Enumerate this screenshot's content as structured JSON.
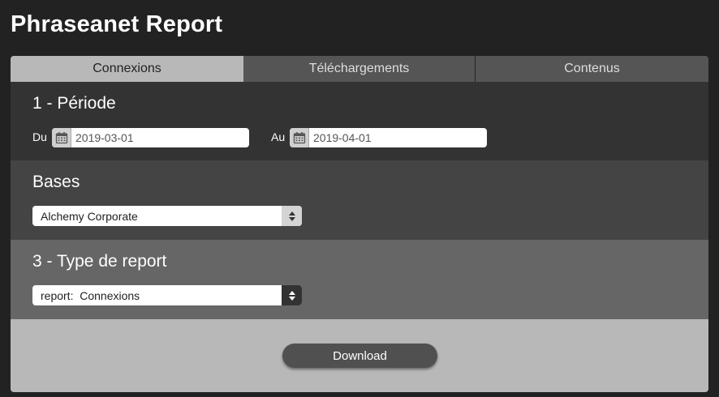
{
  "app": {
    "title": "Phraseanet Report"
  },
  "tabs": [
    {
      "label": "Connexions",
      "active": true
    },
    {
      "label": "Téléchargements",
      "active": false
    },
    {
      "label": "Contenus",
      "active": false
    }
  ],
  "periode": {
    "title": "1 - Période",
    "from": {
      "label": "Du",
      "value": "2019-03-01",
      "icon": "calendar-icon"
    },
    "to": {
      "label": "Au",
      "value": "2019-04-01",
      "icon": "calendar-icon"
    }
  },
  "bases": {
    "title": "Bases",
    "selected": "Alchemy Corporate"
  },
  "type": {
    "title": "3 - Type de report",
    "selected": "report:  Connexions"
  },
  "footer": {
    "download_label": "Download"
  },
  "colors": {
    "background": "#222222",
    "active_tab": "#b8b8b8",
    "inactive_tab": "#555555",
    "button": "#505050"
  }
}
